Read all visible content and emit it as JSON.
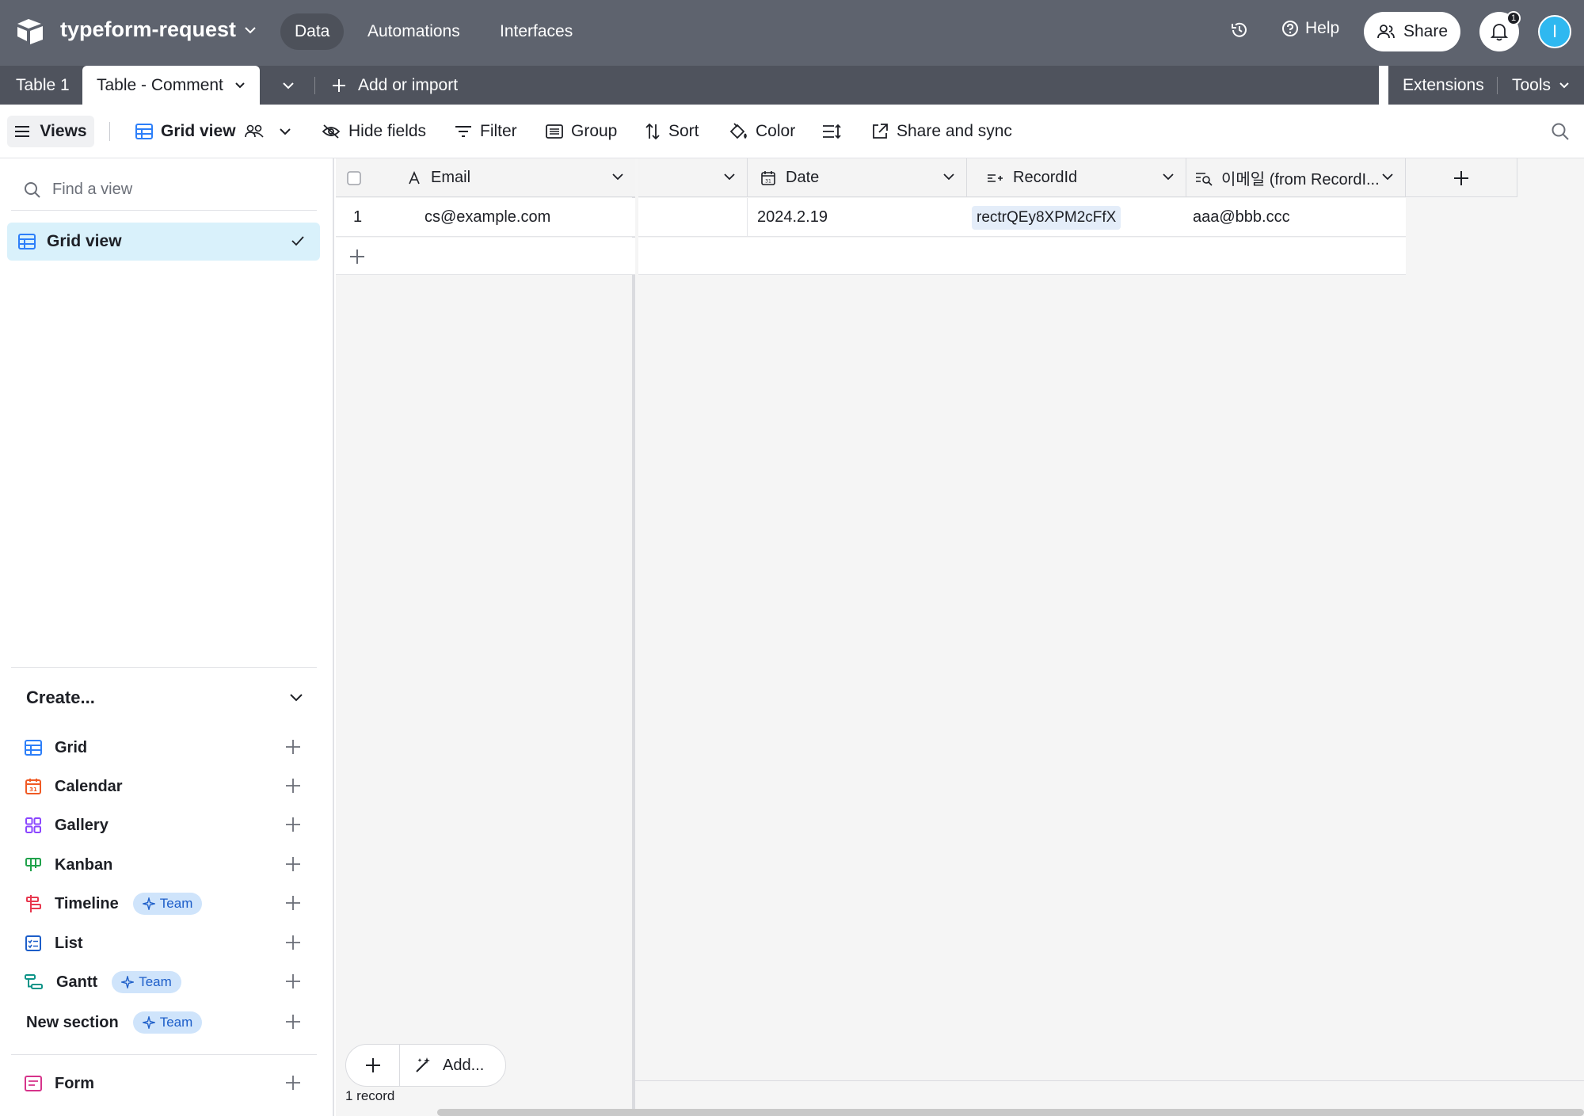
{
  "app": {
    "base_name": "typeform-request",
    "nav": [
      "Data",
      "Automations",
      "Interfaces"
    ],
    "help": "Help",
    "share": "Share",
    "notification_count": "1",
    "avatar_initial": "I"
  },
  "tabs": {
    "table1": "Table 1",
    "table2": "Table - Comment",
    "add_or_import": "Add or import",
    "extensions": "Extensions",
    "tools": "Tools"
  },
  "toolbar": {
    "views": "Views",
    "grid_view": "Grid view",
    "hide_fields": "Hide fields",
    "filter": "Filter",
    "group": "Group",
    "sort": "Sort",
    "color": "Color",
    "share_sync": "Share and sync"
  },
  "sidebar": {
    "find_placeholder": "Find a view",
    "active_view": "Grid view",
    "create_label": "Create...",
    "create_items": [
      {
        "label": "Grid",
        "color": "#2d7ff9"
      },
      {
        "label": "Calendar",
        "color": "#f05a24"
      },
      {
        "label": "Gallery",
        "color": "#8b46ff"
      },
      {
        "label": "Kanban",
        "color": "#20a24b"
      },
      {
        "label": "Timeline",
        "color": "#e8384f",
        "badge": "Team"
      },
      {
        "label": "List",
        "color": "#1d5ec9"
      },
      {
        "label": "Gantt",
        "color": "#0d9488",
        "badge": "Team"
      }
    ],
    "new_section": "New section",
    "new_section_badge": "Team",
    "form": "Form"
  },
  "grid": {
    "columns": [
      "Email",
      "",
      "Date",
      "RecordId",
      "이메일 (from RecordI..."
    ],
    "rows": [
      {
        "num": "1",
        "email": "cs@example.com",
        "blank": "",
        "date": "2024.2.19",
        "record_id": "rectrQEy8XPM2cFfX",
        "lookup": "aaa@bbb.ccc"
      }
    ],
    "add_label": "Add...",
    "record_count": "1 record"
  }
}
